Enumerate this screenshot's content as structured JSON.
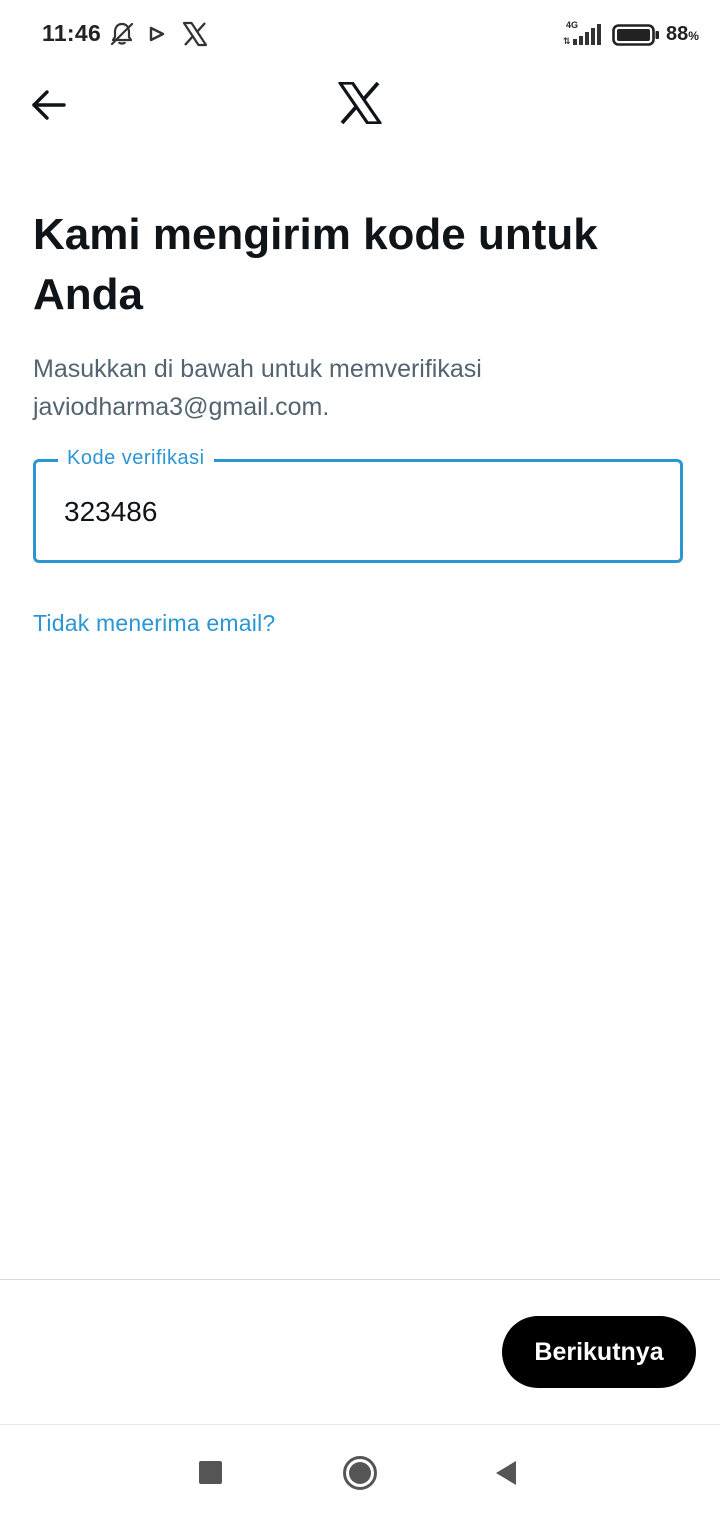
{
  "status_bar": {
    "time": "11:46",
    "network": "4G",
    "battery_percent": "88",
    "battery_unit": "%",
    "icons": [
      "bell-off-icon",
      "play-store-icon",
      "x-app-icon",
      "signal-icon",
      "battery-icon"
    ]
  },
  "header": {
    "back_icon": "arrow-left-icon",
    "logo_icon": "x-logo-icon"
  },
  "main": {
    "title": "Kami mengirim kode untuk Anda",
    "subtitle_line1": "Masukkan di bawah untuk memverifikasi",
    "subtitle_line2": "javiodharma3@gmail.com.",
    "code_field": {
      "label": "Kode verifikasi",
      "value": "323486"
    },
    "resend_link": "Tidak menerima email?"
  },
  "footer": {
    "next_button": "Berikutnya"
  },
  "system_nav": {
    "icons": [
      "recents-icon",
      "home-icon",
      "back-icon"
    ]
  },
  "colors": {
    "accent": "#2a96d3",
    "title": "#0f1419",
    "subtitle": "#536471",
    "button_bg": "#000000",
    "button_text": "#ffffff"
  }
}
